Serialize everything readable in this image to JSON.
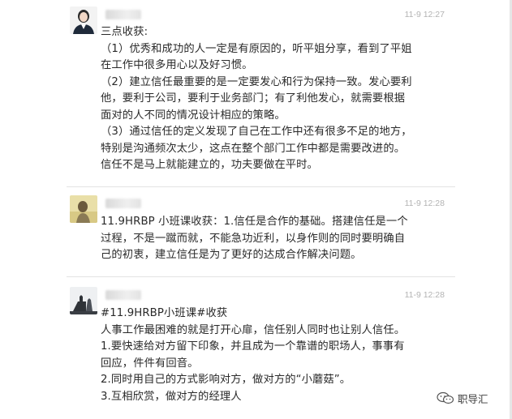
{
  "messages": [
    {
      "time": "11-9 12:27",
      "lines": [
        "三点收获:",
        "（1）优秀和成功的人一定是有原因的，听平姐分享，看到了平姐",
        "在工作中很多用心以及好习惯。",
        "（2）建立信任最重要的是一定要发心和行为保持一致。发心要利",
        "他，要利于公司，要利于业务部门；有了利他发心，就需要根据",
        "面对的人不同的情况设计相应的策略。",
        "（3）通过信任的定义发现了自己在工作中还有很多不足的地方，",
        "特别是沟通频次太少，这点在整个部门工作中都是需要改进的。",
        "信任不是马上就能建立的，功夫要做在平时。"
      ]
    },
    {
      "time": "11-9 12:28",
      "lines": [
        "11.9HRBP 小班课收获：1.信任是合作的基础。搭建信任是一个",
        "过程，不是一蹴而就，不能急功近利，以身作则的同时要明确自",
        "己的初衷，建立信任是为了更好的达成合作解决问题。"
      ]
    },
    {
      "time": "11-9 12:28",
      "lines": [
        "#11.9HRBP小班课#收获",
        "人事工作最困难的就是打开心扉，信任别人同时也让别人信任。",
        "1.要快速给对方留下印象，并且成为一个靠谱的职场人，事事有",
        "回应，件件有回音。",
        "2.同时用自己的方式影响对方，做对方的“小蘑菇”。",
        "3.互相欣赏，做对方的经理人"
      ]
    }
  ],
  "watermark": {
    "label": "职导汇",
    "icon": "wechat-icon"
  }
}
